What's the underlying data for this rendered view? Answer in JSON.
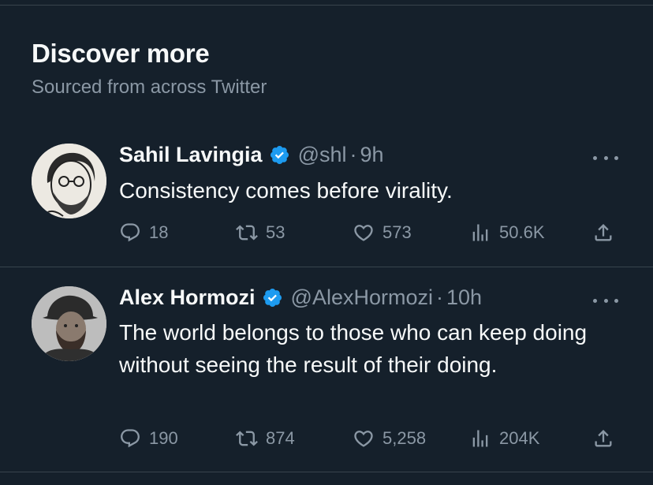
{
  "header": {
    "title": "Discover more",
    "subtitle": "Sourced from across Twitter"
  },
  "colors": {
    "background": "#15202b",
    "text_primary": "#f7f9f9",
    "text_secondary": "#8b98a5",
    "divider": "#38444d",
    "verified_badge": "#1d9bf0"
  },
  "tweets": [
    {
      "name": "Sahil Lavingia",
      "verified_icon": "verified-badge-icon",
      "handle": "@shl",
      "separator": "·",
      "time": "9h",
      "text": "Consistency comes before virality.",
      "replies": "18",
      "retweets": "53",
      "likes": "573",
      "views": "50.6K",
      "avatar_icon": "sketch-portrait-avatar"
    },
    {
      "name": "Alex Hormozi",
      "verified_icon": "verified-badge-icon",
      "handle": "@AlexHormozi",
      "separator": "·",
      "time": "10h",
      "text": "The world belongs to those who can keep doing without seeing the result of their doing.",
      "replies": "190",
      "retweets": "874",
      "likes": "5,258",
      "views": "204K",
      "avatar_icon": "photo-portrait-avatar"
    }
  ]
}
